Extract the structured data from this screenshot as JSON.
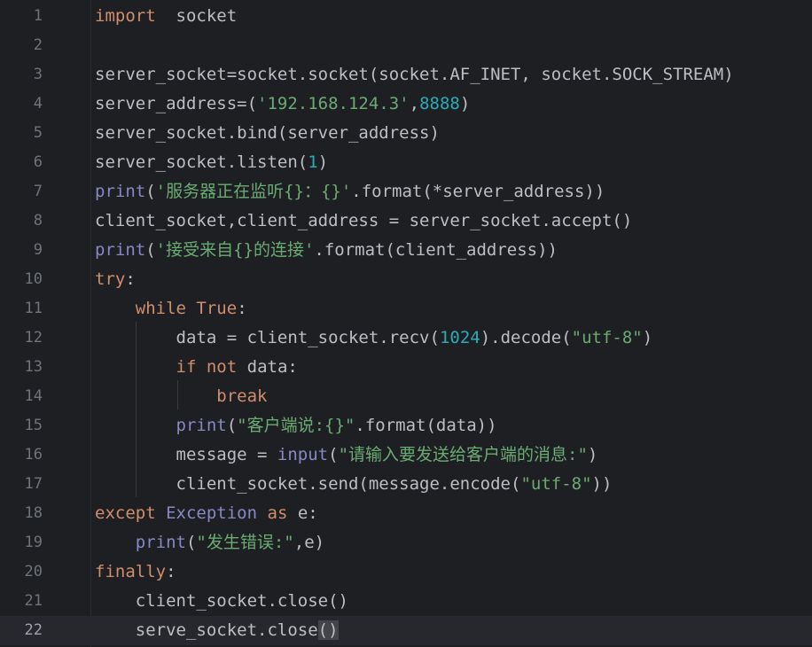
{
  "editor": {
    "lines": [
      {
        "n": "1",
        "html": "<span class=\"kw\">import</span>  socket"
      },
      {
        "n": "2",
        "html": ""
      },
      {
        "n": "3",
        "html": "server_socket=socket.socket(socket.AF_INET, socket.SOCK_STREAM)"
      },
      {
        "n": "4",
        "html": "server_address=(<span class=\"str\">'192.168.124.3'</span>,<span class=\"num\">8888</span>)"
      },
      {
        "n": "5",
        "html": "server_socket.bind(server_address)"
      },
      {
        "n": "6",
        "html": "server_socket.listen(<span class=\"num\">1</span>)"
      },
      {
        "n": "7",
        "html": "<span class=\"bi\">print</span>(<span class=\"str\">'服务器正在监听{}：{}'</span>.format(*server_address))"
      },
      {
        "n": "8",
        "html": "client_socket,client_address = server_socket.accept()"
      },
      {
        "n": "9",
        "html": "<span class=\"bi\">print</span>(<span class=\"str\">'接受来自{}的连接'</span>.format(client_address))"
      },
      {
        "n": "10",
        "html": "<span class=\"kw\">try</span>:"
      },
      {
        "n": "11",
        "html": "    <span class=\"kw\">while</span> <span class=\"kw\">True</span>:"
      },
      {
        "n": "12",
        "html": "        data = client_socket.recv(<span class=\"num\">1024</span>).decode(<span class=\"str\">\"utf-8\"</span>)"
      },
      {
        "n": "13",
        "html": "        <span class=\"kw\">if</span> <span class=\"kw\">not</span> data:"
      },
      {
        "n": "14",
        "html": "            <span class=\"kw\">break</span>"
      },
      {
        "n": "15",
        "html": "        <span class=\"bi\">print</span>(<span class=\"str\">\"客户端说:{}\"</span>.format(data))"
      },
      {
        "n": "16",
        "html": "        message = <span class=\"bi\">input</span>(<span class=\"str\">\"请输入要发送给客户端的消息:\"</span>)"
      },
      {
        "n": "17",
        "html": "        client_socket.send(message.encode(<span class=\"str\">\"utf-8\"</span>))"
      },
      {
        "n": "18",
        "html": "<span class=\"kw\">except</span> <span class=\"bi\">Exception</span> <span class=\"kw\">as</span> e:"
      },
      {
        "n": "19",
        "html": "    <span class=\"bi\">print</span>(<span class=\"str\">\"发生错误:\"</span>,e)"
      },
      {
        "n": "20",
        "html": "<span class=\"kw\">finally</span>:"
      },
      {
        "n": "21",
        "html": "    client_socket.close()"
      },
      {
        "n": "22",
        "html": "    serve_socket.close<span class=\"brace-hl\">()</span>"
      }
    ],
    "current_line": "22"
  }
}
